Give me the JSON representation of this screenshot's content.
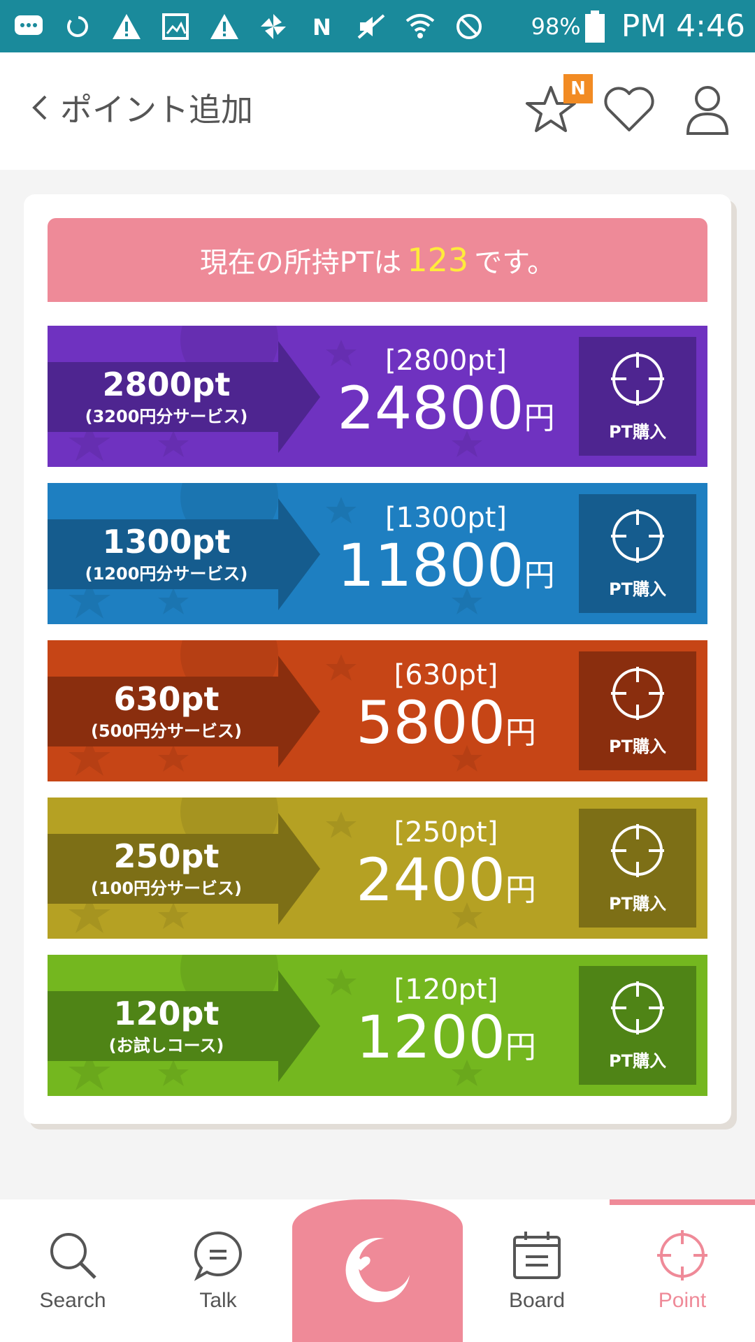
{
  "status_bar": {
    "battery": "98%",
    "time": "PM 4:46",
    "icons": [
      "chat-icon",
      "sync-icon",
      "warning-icon",
      "image-icon",
      "warning-icon",
      "pinwheel-icon",
      "nfc-icon",
      "mute-icon",
      "wifi-icon",
      "blocked-icon"
    ]
  },
  "header": {
    "title": "ポイント追加",
    "badge": "N"
  },
  "balance": {
    "prefix": "現在の所持PTは",
    "points": "123",
    "suffix": "です。"
  },
  "packages": [
    {
      "points_label": "2800pt",
      "bonus": "(3200円分サービス)",
      "bracket": "[2800pt]",
      "price": "24800",
      "unit": "円",
      "buy_label": "PT購入",
      "color": "#6f32c0",
      "dark": "#4e2590"
    },
    {
      "points_label": "1300pt",
      "bonus": "(1200円分サービス)",
      "bracket": "[1300pt]",
      "price": "11800",
      "unit": "円",
      "buy_label": "PT購入",
      "color": "#1e7fc1",
      "dark": "#155c8e"
    },
    {
      "points_label": "630pt",
      "bonus": "(500円分サービス)",
      "bracket": "[630pt]",
      "price": "5800",
      "unit": "円",
      "buy_label": "PT購入",
      "color": "#c64516",
      "dark": "#8a2e0e"
    },
    {
      "points_label": "250pt",
      "bonus": "(100円分サービス)",
      "bracket": "[250pt]",
      "price": "2400",
      "unit": "円",
      "buy_label": "PT購入",
      "color": "#b5a123",
      "dark": "#7d6f16"
    },
    {
      "points_label": "120pt",
      "bonus": "(お試しコース)",
      "bracket": "[120pt]",
      "price": "1200",
      "unit": "円",
      "buy_label": "PT購入",
      "color": "#74b71f",
      "dark": "#4f8416"
    }
  ],
  "nav": {
    "search": "Search",
    "talk": "Talk",
    "board": "Board",
    "point": "Point",
    "accent": "#ef8a98"
  }
}
